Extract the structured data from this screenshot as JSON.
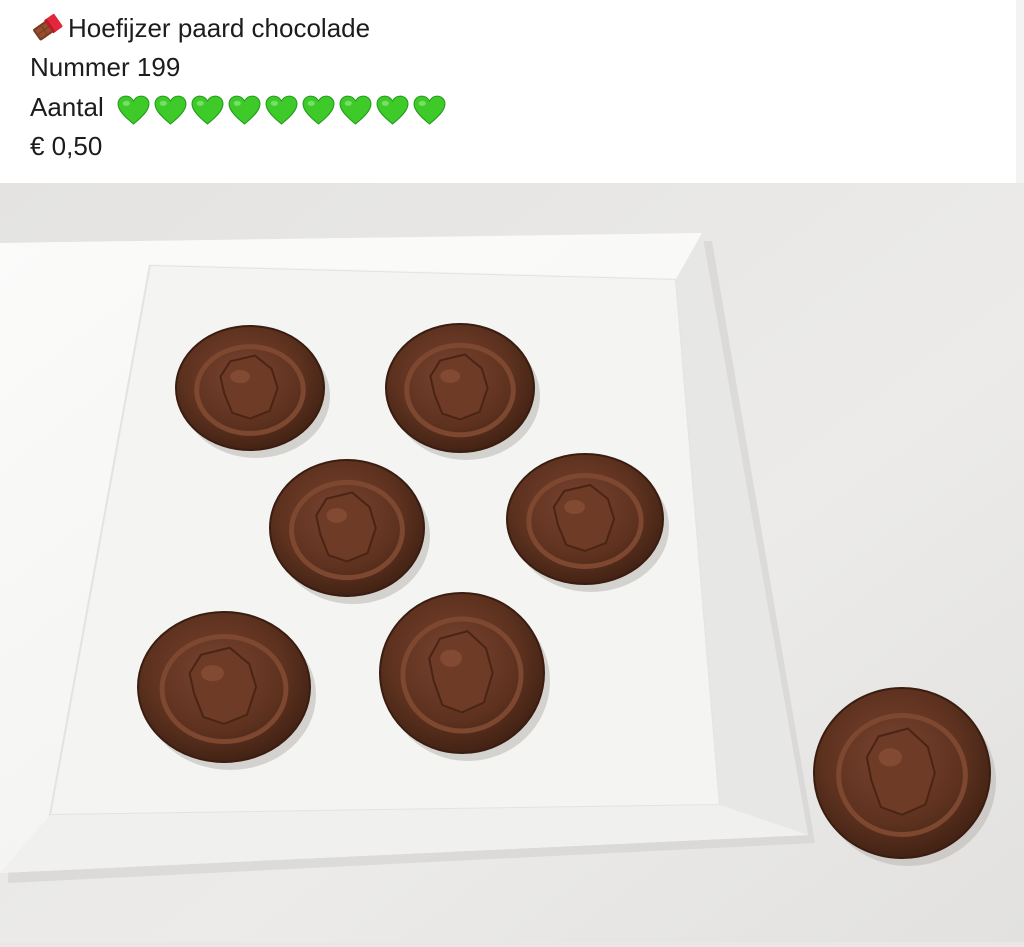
{
  "post": {
    "title_emoji": "chocolate-bar-icon",
    "title": "Hoefijzer paard chocolade",
    "number": "Nummer 199",
    "quantity_label": "Aantal",
    "quantity_hearts": 9,
    "heart_icon": "green-heart-icon",
    "heart_color": "#3ecb2a",
    "price": "€ 0,50"
  },
  "photo": {
    "subject": "horseshoe-horse-chocolates-on-plate",
    "chocolates_on_plate": 6,
    "chocolates_off_plate": 1,
    "chocolate_color": "#5a2f1c",
    "plate_color": "#f7f7f5",
    "table_color": "#e9e8e6"
  }
}
